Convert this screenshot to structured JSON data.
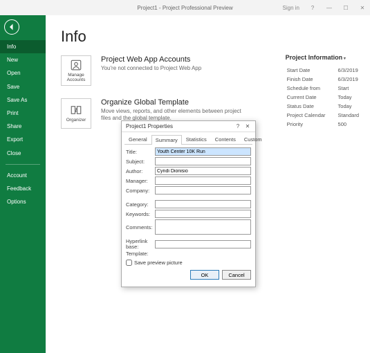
{
  "titlebar": {
    "title": "Project1 - Project Professional Preview",
    "signin": "Sign in"
  },
  "sidebar": {
    "items": [
      "Info",
      "New",
      "Open",
      "Save",
      "Save As",
      "Print",
      "Share",
      "Export",
      "Close"
    ],
    "items2": [
      "Account",
      "Feedback",
      "Options"
    ]
  },
  "page": {
    "title": "Info",
    "section1": {
      "btn": "Manage Accounts",
      "heading": "Project Web App Accounts",
      "desc": "You're not connected to Project Web App"
    },
    "section2": {
      "btn": "Organizer",
      "heading": "Organize Global Template",
      "desc": "Move views, reports, and other elements between project files and the global template."
    }
  },
  "projinfo": {
    "heading": "Project Information",
    "rows": [
      {
        "k": "Start Date",
        "v": "6/3/2019"
      },
      {
        "k": "Finish Date",
        "v": "6/3/2019"
      },
      {
        "k": "Schedule from",
        "v": "Start"
      },
      {
        "k": "Current Date",
        "v": "Today"
      },
      {
        "k": "Status Date",
        "v": "Today"
      },
      {
        "k": "Project Calendar",
        "v": "Standard"
      },
      {
        "k": "Priority",
        "v": "500"
      }
    ]
  },
  "dialog": {
    "title": "Project1 Properties",
    "tabs": [
      "General",
      "Summary",
      "Statistics",
      "Contents",
      "Custom"
    ],
    "fields": {
      "title_lbl": "Title:",
      "title_val": "Youth Center 10K Run",
      "subject_lbl": "Subject:",
      "subject_val": "",
      "author_lbl": "Author:",
      "author_val": "Cyndi Dionisio",
      "manager_lbl": "Manager:",
      "manager_val": "",
      "company_lbl": "Company:",
      "company_val": "",
      "category_lbl": "Category:",
      "category_val": "",
      "keywords_lbl": "Keywords:",
      "keywords_val": "",
      "comments_lbl": "Comments:",
      "comments_val": "",
      "hyperlink_lbl": "Hyperlink base:",
      "hyperlink_val": "",
      "template_lbl": "Template:",
      "template_val": ""
    },
    "chk": "Save preview picture",
    "ok": "OK",
    "cancel": "Cancel"
  }
}
